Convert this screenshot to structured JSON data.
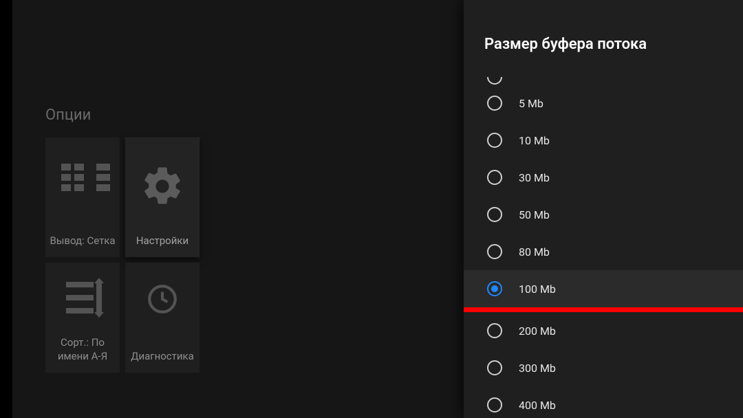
{
  "main": {
    "options_title": "Опции",
    "tiles": {
      "output": {
        "label": "Вывод: Сетка"
      },
      "settings": {
        "label": "Настройки"
      },
      "sort": {
        "label": "Сорт.: По имени А-Я"
      },
      "diagnostics": {
        "label": "Диагностика"
      }
    }
  },
  "drawer": {
    "title": "Размер буфера потока",
    "options": [
      {
        "label": "5 Mb",
        "selected": false
      },
      {
        "label": "10 Mb",
        "selected": false
      },
      {
        "label": "30 Mb",
        "selected": false
      },
      {
        "label": "50 Mb",
        "selected": false
      },
      {
        "label": "80 Mb",
        "selected": false
      },
      {
        "label": "100 Mb",
        "selected": true
      },
      {
        "label": "200 Mb",
        "selected": false
      },
      {
        "label": "300 Mb",
        "selected": false
      },
      {
        "label": "400 Mb",
        "selected": false
      }
    ]
  },
  "colors": {
    "accent": "#1e88ff",
    "highlight_bar": "#ff0000"
  }
}
